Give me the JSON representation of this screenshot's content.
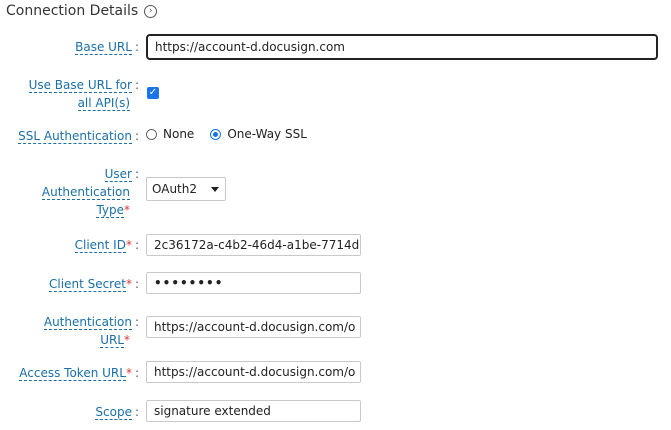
{
  "section": {
    "title": "Connection Details",
    "icon": "chevron-right-circle-icon"
  },
  "fields": {
    "base_url": {
      "label": "Base URL",
      "value": "https://account-d.docusign.com"
    },
    "use_base_url": {
      "label_line1": "Use Base URL for",
      "label_line2": "all API(s)",
      "checked": true
    },
    "ssl_auth": {
      "label": "SSL Authentication",
      "options": [
        "None",
        "One-Way SSL"
      ],
      "selected": "One-Way SSL"
    },
    "auth_type": {
      "label_line1": "User",
      "label_line2": "Authentication",
      "label_line3": "Type",
      "value": "OAuth2"
    },
    "client_id": {
      "label": "Client ID",
      "value": "2c36172a-c4b2-46d4-a1be-7714d"
    },
    "client_secret": {
      "label": "Client Secret",
      "value": "••••••••"
    },
    "auth_url": {
      "label_line1": "Authentication",
      "label_line2": "URL",
      "value": "https://account-d.docusign.com/o"
    },
    "access_token_url": {
      "label": "Access Token URL",
      "value": "https://account-d.docusign.com/o"
    },
    "scope": {
      "label": "Scope",
      "value": "signature extended"
    }
  },
  "symbols": {
    "required": "*",
    "colon": ":"
  }
}
